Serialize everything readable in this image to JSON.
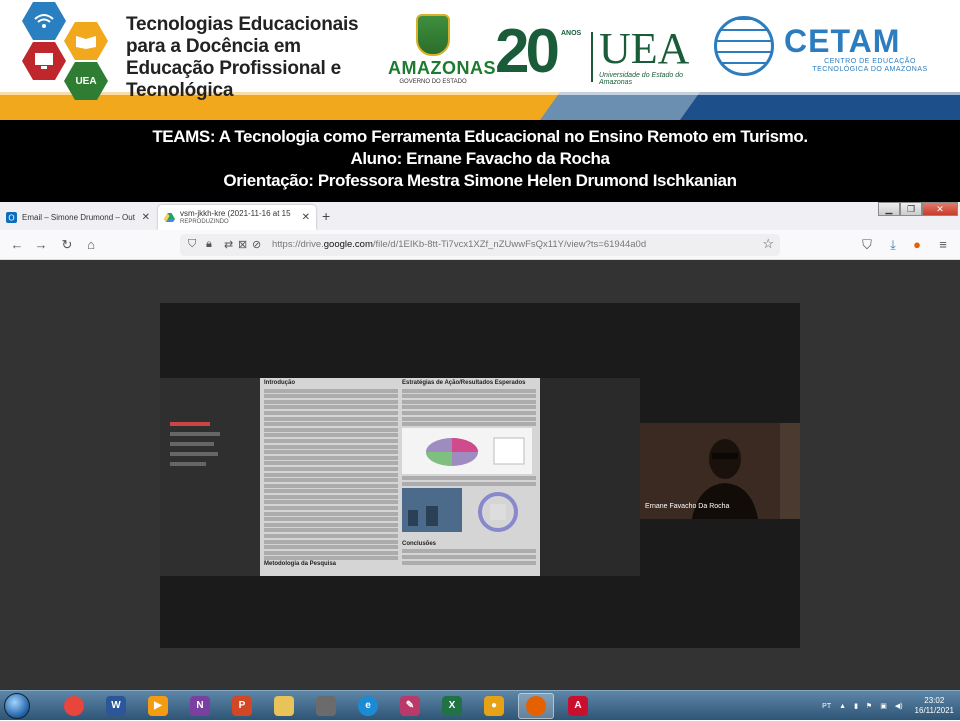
{
  "header": {
    "title": "Tecnologias Educacionais para a Docência em Educação Profissional e Tecnológica",
    "hex_uea_label": "UEA",
    "amazonas_name": "AMAZONAS",
    "amazonas_sub": "GOVERNO DO ESTADO",
    "uea_number": "20",
    "uea_anos": "ANOS",
    "uea_name": "UEA",
    "uea_signature": "Universidade do Estado do Amazonas",
    "cetam_name": "CETAM",
    "cetam_sub": "CENTRO DE EDUCAÇÃO TECNOLÓGICA DO AMAZONAS"
  },
  "title_band": {
    "line1": "TEAMS: A Tecnologia como Ferramenta Educacional no Ensino Remoto em Turismo.",
    "line2": "Aluno: Ernane Favacho da Rocha",
    "line3": "Orientação: Professora Mestra Simone Helen Drumond Ischkanian"
  },
  "browser": {
    "tabs": [
      {
        "label": "Email – Simone Drumond – Out",
        "close": "✕"
      },
      {
        "label": "vsm-jkkh-kre (2021-11-16 at 15",
        "sublabel": "REPRODUZINDO",
        "close": "✕"
      }
    ],
    "new_tab": "+",
    "url_prefix": "https://drive.",
    "url_domain": "google.com",
    "url_rest": "/file/d/1EIKb-8tt-Ti7vcx1XZf_nZUwwFsQx11Y/view?ts=61944a0d",
    "window_buttons": {
      "minimize": "▁",
      "restore": "❐",
      "close": "✕"
    }
  },
  "video": {
    "doc_left_heading": "Introdução",
    "doc_left_heading2": "Metodologia da Pesquisa",
    "doc_right_heading": "Estratégias de Ação/Resultados Esperados",
    "doc_right_heading2": "Conclusões",
    "participant_name": "Ernane Favacho Da Rocha"
  },
  "taskbar": {
    "apps": [
      {
        "icon": "chrome-icon",
        "label": "",
        "color": "#e8453c"
      },
      {
        "icon": "word-icon",
        "label": "W",
        "color": "#2b579a"
      },
      {
        "icon": "media-player-icon",
        "label": "▶",
        "color": "#f39c12"
      },
      {
        "icon": "onenote-icon",
        "label": "N",
        "color": "#7b3fa0"
      },
      {
        "icon": "powerpoint-icon",
        "label": "P",
        "color": "#d24726"
      },
      {
        "icon": "folder-icon",
        "label": "",
        "color": "#e7c35a"
      },
      {
        "icon": "film-icon",
        "label": "",
        "color": "#6b6b6b"
      },
      {
        "icon": "edge-icon",
        "label": "e",
        "color": "#1b8bd6"
      },
      {
        "icon": "edit-icon",
        "label": "✎",
        "color": "#b93a6a"
      },
      {
        "icon": "excel-icon",
        "label": "X",
        "color": "#217346"
      },
      {
        "icon": "app-icon",
        "label": "●",
        "color": "#e6a117"
      },
      {
        "icon": "firefox-icon",
        "label": "",
        "color": "#e66000"
      },
      {
        "icon": "acrobat-icon",
        "label": "A",
        "color": "#c8102e"
      }
    ],
    "language": "PT",
    "time": "23:02",
    "date": "16/11/2021"
  }
}
